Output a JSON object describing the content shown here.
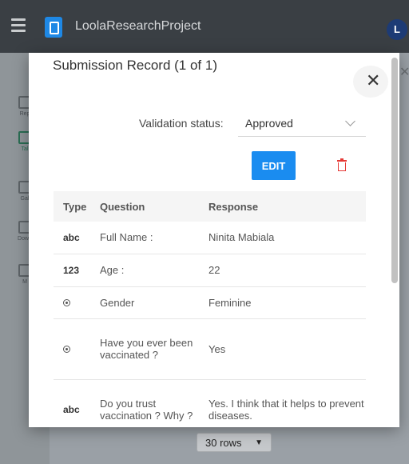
{
  "app": {
    "title": "LoolaResearchProject",
    "avatar_initial": "L"
  },
  "sidebar": {
    "items": [
      {
        "label": "Rep",
        "icon": "report-icon"
      },
      {
        "label": "Tal",
        "icon": "table-icon"
      },
      {
        "label": "Gal",
        "icon": "gallery-icon"
      },
      {
        "label": "Down",
        "icon": "download-icon"
      },
      {
        "label": "M",
        "icon": "map-icon"
      }
    ]
  },
  "pagination": {
    "rows_label": "30 rows"
  },
  "dialog": {
    "title": "Submission Record (1 of 1)",
    "validation_label": "Validation status:",
    "validation_value": "Approved",
    "edit_label": "EDIT",
    "columns": {
      "type": "Type",
      "question": "Question",
      "response": "Response"
    },
    "rows": [
      {
        "type": "abc",
        "question": "Full Name :",
        "response": "Ninita Mabiala"
      },
      {
        "type": "123",
        "question": "Age :",
        "response": "22"
      },
      {
        "type": "radio-icon",
        "question": "Gender",
        "response": "Feminine"
      },
      {
        "type": "radio-icon",
        "question": "Have you ever been vaccinated ?",
        "response": "Yes"
      },
      {
        "type": "abc",
        "question": "Do you trust vaccination ? Why ?",
        "response": "Yes. I think that it helps to prevent diseases."
      }
    ]
  },
  "colors": {
    "edit_button": "#1a8cf0",
    "delete_icon": "#e53935",
    "topbar": "#3a3f44"
  }
}
